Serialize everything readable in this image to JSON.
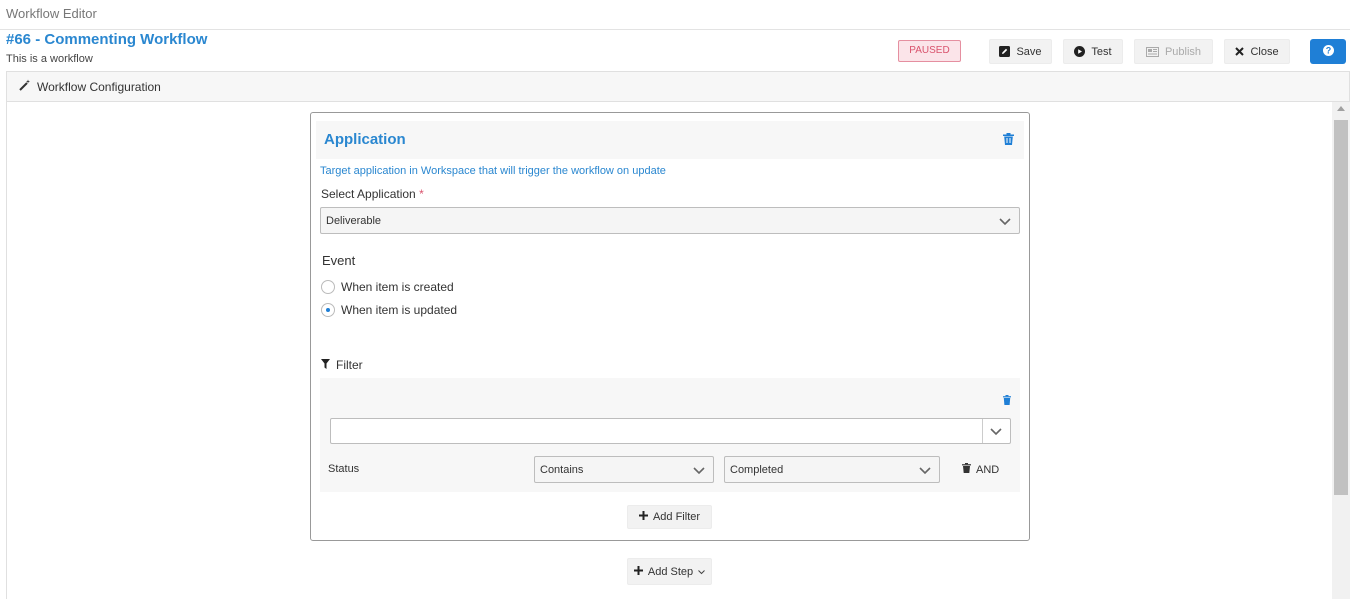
{
  "app": {
    "title": "Workflow Editor"
  },
  "workflow": {
    "title": "#66 - Commenting Workflow",
    "subtitle": "This is a workflow",
    "status": "PAUSED"
  },
  "toolbar": {
    "save": "Save",
    "test": "Test",
    "publish": "Publish",
    "close": "Close"
  },
  "config_bar": {
    "label": "Workflow Configuration"
  },
  "step": {
    "title": "Application",
    "hint": "Target application in Workspace that will trigger the workflow on update",
    "select_label": "Select Application",
    "required_mark": "*",
    "application_value": "Deliverable",
    "event_label": "Event",
    "events": [
      {
        "label": "When item is created",
        "selected": false
      },
      {
        "label": "When item is updated",
        "selected": true
      }
    ],
    "filter_label": "Filter",
    "filter": {
      "field_value": "",
      "row": {
        "field": "Status",
        "operator": "Contains",
        "value": "Completed",
        "conjunction": "AND"
      }
    },
    "add_filter": "Add Filter"
  },
  "add_step": "Add Step",
  "colors": {
    "accent": "#2a87d0",
    "badge": "#d9536d",
    "primary": "#1f7fd6"
  }
}
